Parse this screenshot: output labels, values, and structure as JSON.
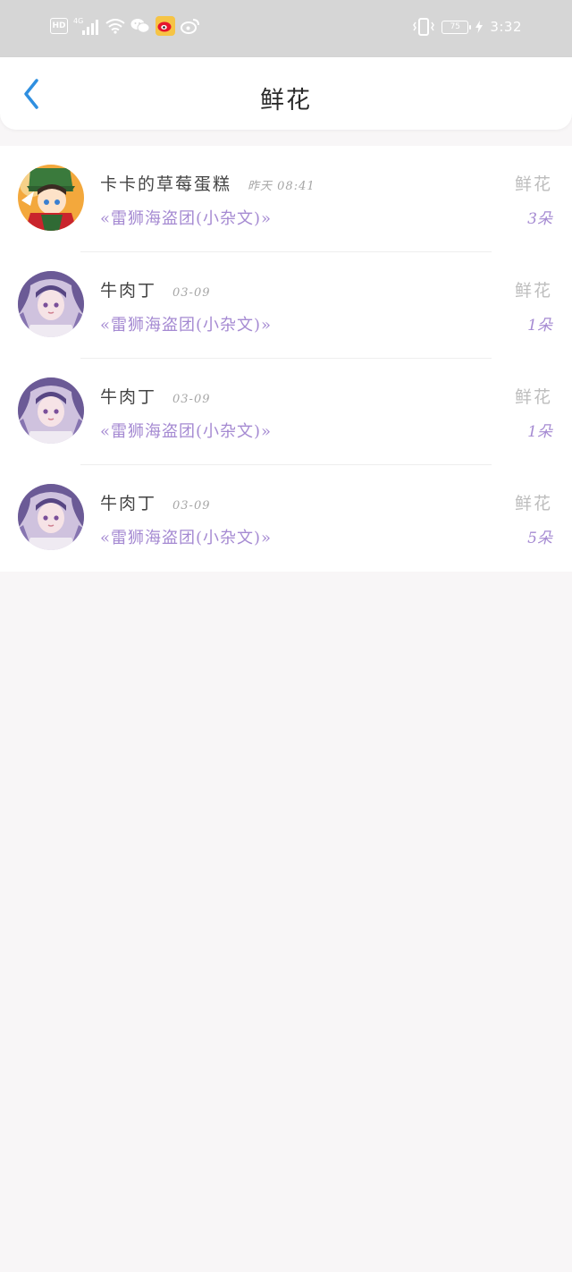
{
  "status_bar": {
    "hd": "HD",
    "network": "4G",
    "battery": "75",
    "time": "3:32"
  },
  "header": {
    "title": "鲜花"
  },
  "records": [
    {
      "name": "卡卡的草莓蛋糕",
      "time": "昨天 08:41",
      "book": "«雷狮海盗团(小杂文)»",
      "gift": "鲜花",
      "count": "3朵",
      "avatar": "green-character-avatar"
    },
    {
      "name": "牛肉丁",
      "time": "03-09",
      "book": "«雷狮海盗团(小杂文)»",
      "gift": "鲜花",
      "count": "1朵",
      "avatar": "purple-hair-girl-avatar"
    },
    {
      "name": "牛肉丁",
      "time": "03-09",
      "book": "«雷狮海盗团(小杂文)»",
      "gift": "鲜花",
      "count": "1朵",
      "avatar": "purple-hair-girl-avatar"
    },
    {
      "name": "牛肉丁",
      "time": "03-09",
      "book": "«雷狮海盗团(小杂文)»",
      "gift": "鲜花",
      "count": "5朵",
      "avatar": "purple-hair-girl-avatar"
    }
  ],
  "colors": {
    "accent_blue": "#2f8fe0",
    "book_purple": "#a58ad2",
    "gift_gray": "#bdbdbd",
    "status_bar_bg": "#d6d6d6",
    "page_bg": "#f8f6f7"
  }
}
